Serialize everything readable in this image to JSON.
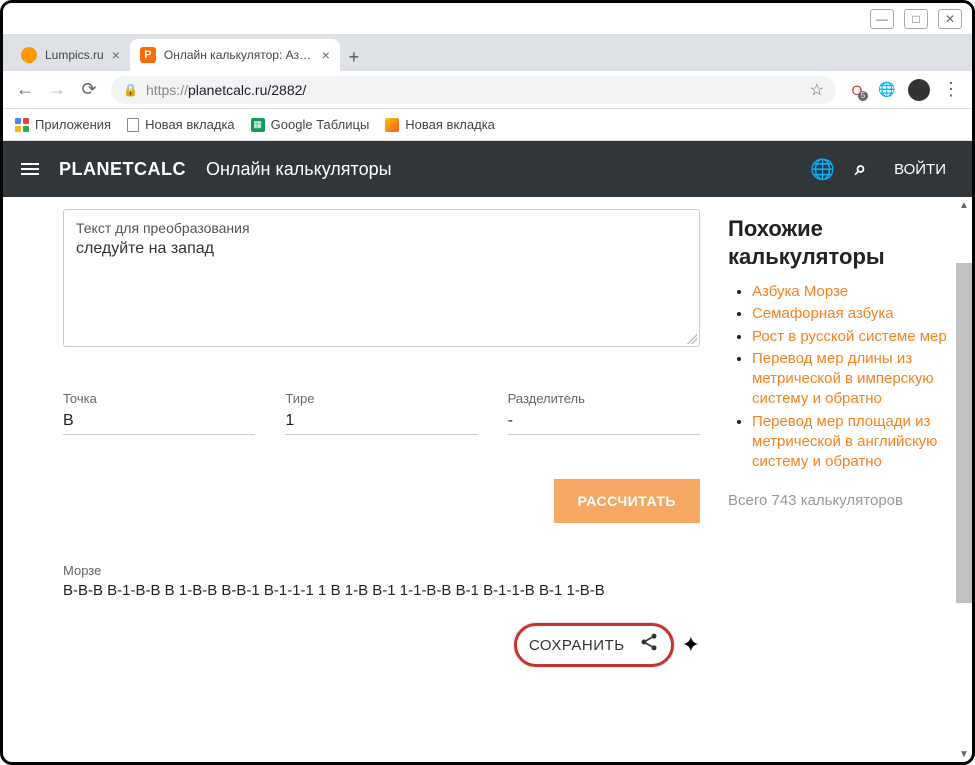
{
  "tabs": [
    {
      "title": "Lumpics.ru"
    },
    {
      "title": "Онлайн калькулятор: Азбука Mo"
    }
  ],
  "url": {
    "https": "https://",
    "rest": "planetcalc.ru/2882/"
  },
  "bookmarks": {
    "apps": "Приложения",
    "new_tab1": "Новая вкладка",
    "sheets": "Google Таблицы",
    "new_tab2": "Новая вкладка"
  },
  "header": {
    "logo": "PLANETCALC",
    "subtitle": "Онлайн калькуляторы",
    "login": "ВОЙТИ"
  },
  "form": {
    "textarea_label": "Текст для преобразования",
    "textarea_value": "следуйте на запад",
    "dot_label": "Точка",
    "dot_value": "B",
    "dash_label": "Тире",
    "dash_value": "1",
    "sep_label": "Разделитель",
    "sep_value": "-",
    "calc_btn": "РАССЧИТАТЬ"
  },
  "result": {
    "label": "Морзе",
    "value": "B-B-B B-1-B-B B 1-B-B B-B-1 B-1-1-1 1 B 1-B B-1 1-1-B-B B-1 B-1-1-B B-1 1-B-B"
  },
  "actions": {
    "save": "СОХРАНИТЬ"
  },
  "sidebar": {
    "title": "Похожие калькуляторы",
    "items": [
      "Азбука Морзе",
      "Семафорная азбука",
      "Рост в русской системе мер",
      "Перевод мер длины из метрической в имперскую систему и обратно",
      "Перевод мер площади из метрической в английскую систему и обратно"
    ],
    "footer": "Всего 743 калькуляторов"
  }
}
